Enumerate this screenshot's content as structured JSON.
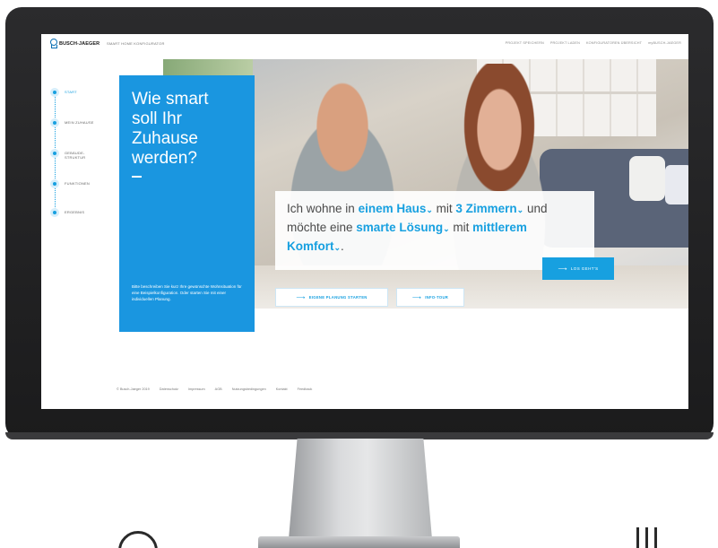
{
  "brand": {
    "logo_text": "BUSCH-JAEGER",
    "app_title": "SMART HOME KONFIGURATOR",
    "accent_color": "#1a96e0"
  },
  "topnav": {
    "items": [
      "PROJEKT SPEICHERN",
      "PROJEKT LADEN",
      "KONFIGURATOREN ÜBERSICHT",
      "myBUSCH-JAEGER"
    ]
  },
  "steps": {
    "items": [
      {
        "label": "START",
        "active": true
      },
      {
        "label": "MEIN ZUHAUSE",
        "active": false
      },
      {
        "label": "GEBÄUDE-STRUKTUR",
        "active": false
      },
      {
        "label": "FUNKTIONEN",
        "active": false
      },
      {
        "label": "ERGEBNIS",
        "active": false
      }
    ]
  },
  "panel": {
    "heading": "Wie smart soll Ihr Zuhause werden?",
    "description": "Bitte beschreiben Sie kurz Ihre gewünschte Wohnsituation für eine Beispielkonfiguration. Oder starten Sie mit einer individuellen Planung."
  },
  "sentence": {
    "t1": "Ich wohne in ",
    "home_type": "einem Haus",
    "t2": " mit ",
    "rooms": "3 Zimmern",
    "t3": " und möchte eine ",
    "solution": "smarte Lösung",
    "t4": " mit ",
    "comfort": "mittlerem Komfort",
    "t5": "."
  },
  "buttons": {
    "go": "LOS GEHT'S",
    "own_planning": "EIGENE PLANUNG STARTEN",
    "info_tour": "INFO-TOUR"
  },
  "footer": {
    "items": [
      "© Busch-Jaeger 2019",
      "Datenschutz",
      "Impressum",
      "AGB",
      "Nutzungsbedingungen",
      "Kontakt",
      "Feedback"
    ]
  }
}
